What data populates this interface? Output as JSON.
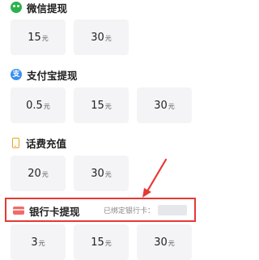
{
  "sections": {
    "wechat": {
      "title": "微信提现",
      "icon": "wechat-icon",
      "amounts": [
        {
          "value": "15",
          "unit": "元"
        },
        {
          "value": "30",
          "unit": "元"
        }
      ]
    },
    "alipay": {
      "title": "支付宝提现",
      "icon": "alipay-icon",
      "amounts": [
        {
          "value": "0.5",
          "unit": "元"
        },
        {
          "value": "15",
          "unit": "元"
        },
        {
          "value": "30",
          "unit": "元"
        }
      ]
    },
    "phone": {
      "title": "话费充值",
      "icon": "phone-icon",
      "amounts": [
        {
          "value": "20",
          "unit": "元"
        },
        {
          "value": "30",
          "unit": "元"
        }
      ]
    },
    "bank": {
      "title": "银行卡提现",
      "icon": "bank-card-icon",
      "bound_label": "已绑定银行卡：",
      "amounts": [
        {
          "value": "3",
          "unit": "元"
        },
        {
          "value": "15",
          "unit": "元"
        },
        {
          "value": "30",
          "unit": "元"
        }
      ]
    }
  },
  "colors": {
    "highlight": "#e53935",
    "tile_bg": "#f4f4f6",
    "wechat": "#2bb24c",
    "alipay": "#3a8ff0",
    "phone": "#f0a020",
    "bank": "#f26a6a"
  }
}
